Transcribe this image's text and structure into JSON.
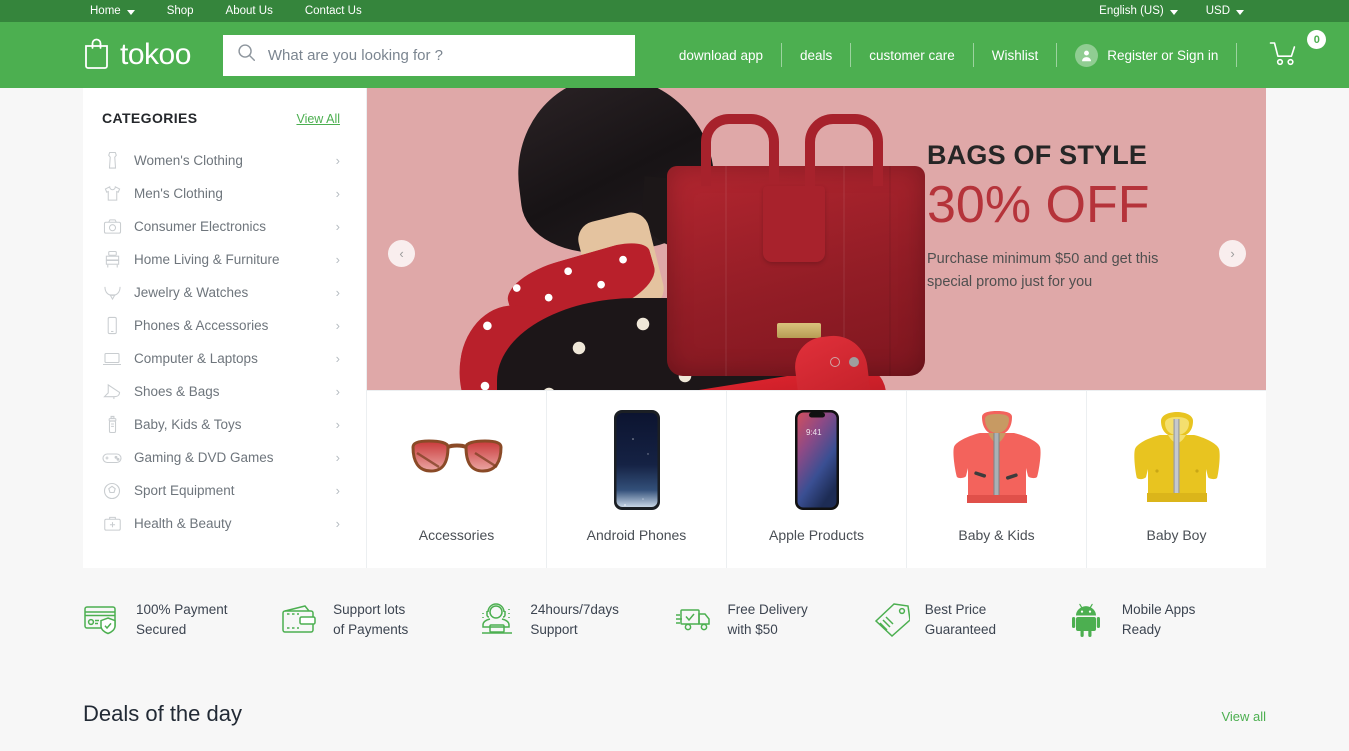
{
  "topbar": {
    "nav": [
      {
        "label": "Home",
        "icon": "chevron-down-icon",
        "has_caret": true
      },
      {
        "label": "Shop",
        "has_caret": false
      },
      {
        "label": "About Us",
        "has_caret": false
      },
      {
        "label": "Contact Us",
        "has_caret": false
      }
    ],
    "language": "English (US)",
    "currency": "USD"
  },
  "header": {
    "brand": "tokoo",
    "brand_icon": "shopping-bag-icon",
    "search": {
      "placeholder": "What are you looking for ?",
      "value": "",
      "icon": "search-icon"
    },
    "links": [
      {
        "label": "download app"
      },
      {
        "label": "deals"
      },
      {
        "label": "customer care"
      },
      {
        "label": "Wishlist"
      }
    ],
    "account_label": "Register or Sign in",
    "account_icon": "user-avatar-icon",
    "cart_icon": "shopping-cart-icon",
    "cart_count": "0"
  },
  "sidebar": {
    "title": "CATEGORIES",
    "view_all": "View All",
    "items": [
      {
        "label": "Women's Clothing",
        "icon": "dress-icon"
      },
      {
        "label": "Men's Clothing",
        "icon": "tshirt-icon"
      },
      {
        "label": "Consumer Electronics",
        "icon": "camera-icon"
      },
      {
        "label": "Home Living & Furniture",
        "icon": "dresser-icon"
      },
      {
        "label": "Jewelry & Watches",
        "icon": "necklace-icon"
      },
      {
        "label": "Phones & Accessories",
        "icon": "smartphone-icon"
      },
      {
        "label": "Computer & Laptops",
        "icon": "laptop-icon"
      },
      {
        "label": "Shoes & Bags",
        "icon": "high-heel-icon"
      },
      {
        "label": "Baby, Kids & Toys",
        "icon": "baby-bottle-icon"
      },
      {
        "label": "Gaming & DVD Games",
        "icon": "gamepad-icon"
      },
      {
        "label": "Sport Equipment",
        "icon": "soccer-ball-icon"
      },
      {
        "label": "Health & Beauty",
        "icon": "first-aid-kit-icon"
      }
    ]
  },
  "hero": {
    "title": "BAGS OF STYLE",
    "discount": "30% OFF",
    "subtitle": "Purchase minimum $50 and get this special promo just for you",
    "prev_icon": "chevron-left-icon",
    "next_icon": "chevron-right-icon",
    "slides": 2,
    "active_slide": 2,
    "background_color": "#dfa8a8",
    "discount_color": "#b5333a"
  },
  "category_cards": [
    {
      "label": "Accessories",
      "image": "sunglasses-image"
    },
    {
      "label": "Android Phones",
      "image": "android-phone-image"
    },
    {
      "label": "Apple Products",
      "image": "iphone-image"
    },
    {
      "label": "Baby & Kids",
      "image": "pink-jacket-image"
    },
    {
      "label": "Baby Boy",
      "image": "yellow-jacket-image"
    }
  ],
  "features": [
    {
      "line1": "100% Payment",
      "line2": "Secured",
      "icon": "credit-card-shield-icon"
    },
    {
      "line1": "Support lots",
      "line2": "of Payments",
      "icon": "wallet-icon"
    },
    {
      "line1": "24hours/7days",
      "line2": "Support",
      "icon": "headset-support-icon"
    },
    {
      "line1": "Free Delivery",
      "line2": "with $50",
      "icon": "delivery-truck-icon"
    },
    {
      "line1": "Best Price",
      "line2": "Guaranteed",
      "icon": "price-tag-icon"
    },
    {
      "line1": "Mobile Apps",
      "line2": "Ready",
      "icon": "android-robot-icon"
    }
  ],
  "deals": {
    "title": "Deals of the day",
    "view_all": "View all"
  },
  "colors": {
    "topbar_green": "#35853c",
    "header_green": "#4caf50",
    "accent_green": "#4caf50",
    "page_bg": "#f7f7f7"
  }
}
